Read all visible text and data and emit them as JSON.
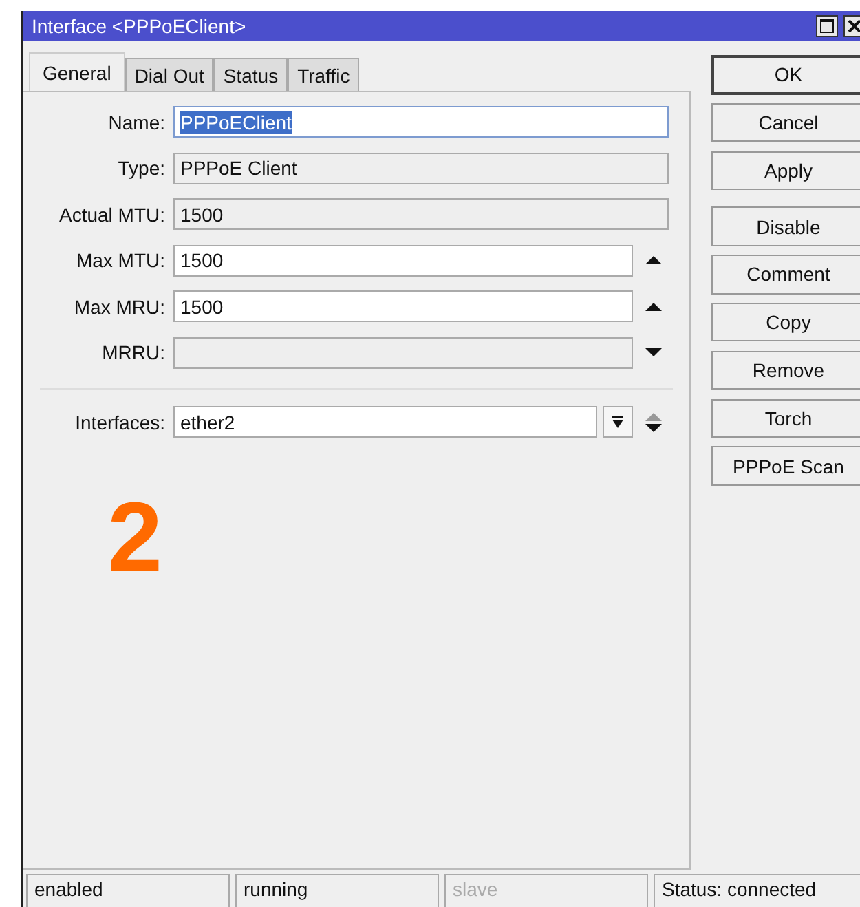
{
  "window": {
    "title": "Interface <PPPoEClient>"
  },
  "tabs": [
    {
      "label": "General",
      "selected": true
    },
    {
      "label": "Dial Out",
      "selected": false
    },
    {
      "label": "Status",
      "selected": false
    },
    {
      "label": "Traffic",
      "selected": false
    }
  ],
  "fields": [
    {
      "label": "Name:",
      "value": "PPPoEClient",
      "readonly": false,
      "text_selected": true,
      "kind": "plain"
    },
    {
      "label": "Type:",
      "value": "PPPoE Client",
      "readonly": true,
      "text_selected": false,
      "kind": "plain"
    },
    {
      "label": "Actual MTU:",
      "value": "1500",
      "readonly": true,
      "text_selected": false,
      "kind": "plain"
    },
    {
      "label": "Max MTU:",
      "value": "1500",
      "readonly": false,
      "text_selected": false,
      "kind": "spin_up"
    },
    {
      "label": "Max MRU:",
      "value": "1500",
      "readonly": false,
      "text_selected": false,
      "kind": "spin_up"
    },
    {
      "label": "MRRU:",
      "readonly": true,
      "text_selected": false,
      "kind": "spin_down"
    }
  ],
  "interfaces": {
    "label": "Interfaces:",
    "value": "ether2"
  },
  "annotation": "2",
  "buttons": [
    "OK",
    "Cancel",
    "Apply",
    "Disable",
    "Comment",
    "Copy",
    "Remove",
    "Torch",
    "PPPoE Scan"
  ],
  "status_bar": [
    {
      "text": "enabled",
      "disabled": false
    },
    {
      "text": "running",
      "disabled": false
    },
    {
      "text": "slave",
      "disabled": true
    },
    {
      "text": "Status: connected",
      "disabled": false
    }
  ]
}
